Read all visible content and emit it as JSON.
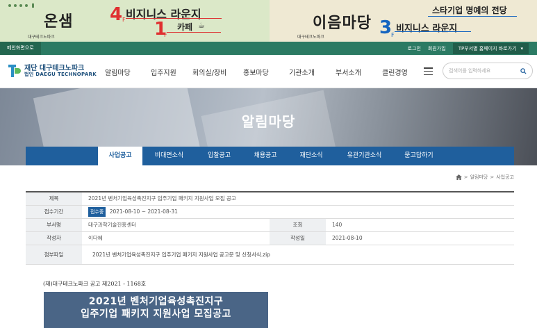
{
  "banner": {
    "left": {
      "title": "온샘",
      "floor1_number": "4",
      "floor1_unit": "F",
      "floor1_title": "비지니스 라운지",
      "floor2_number": "1",
      "floor2_unit": "F",
      "floor2_title": "카페",
      "org_small": "대구테크노파크"
    },
    "right": {
      "title": "이음마당",
      "top_title": "스타기업 명예의 전당",
      "floor_number": "3",
      "floor_unit": "F",
      "floor_title": "비지니스 라운지",
      "org_small": "대구테크노파크"
    }
  },
  "utilbar": {
    "home_link": "메인화면으로",
    "login": "로그인",
    "join": "회원가입",
    "tp_select": "TP부서별 홈페이지 바로가기"
  },
  "header": {
    "logo_ko": "재단 대구테크노파크",
    "logo_en": "법인 DAEGU TECHNOPARK",
    "nav": [
      "알림마당",
      "입주지원",
      "회의실/장비",
      "홍보마당",
      "기관소개",
      "부서소개",
      "클린경영"
    ],
    "search_placeholder": "검색어를 입력하세요"
  },
  "hero": {
    "title": "알림마당"
  },
  "subnav": {
    "items": [
      "사업공고",
      "비대면소식",
      "입찰공고",
      "채용공고",
      "재단소식",
      "유관기관소식",
      "묻고답하기"
    ],
    "active_index": 0
  },
  "breadcrumb": {
    "level1": "알림마당",
    "level2": "사업공고"
  },
  "post": {
    "title_label": "제목",
    "title_value": "2021년 벤처기업육성촉진지구 입주기업 패키지 지원사업 모집 공고",
    "period_label": "접수기간",
    "period_badge": "접수중",
    "period_value": "2021-08-10 ~ 2021-08-31",
    "dept_label": "부서명",
    "dept_value": "대구과학기술진흥센터",
    "views_label": "조회",
    "views_value": "140",
    "author_label": "작성자",
    "author_value": "이다혜",
    "date_label": "작성일",
    "date_value": "2021-08-10",
    "attach_label": "첨부파일",
    "attach_value": "2021년 벤처기업육성촉진지구 입주기업 패키지 지원사업 공고문 및 신청서식.zip"
  },
  "body": {
    "doc_no": "(재)대구테크노파크 공고 제2021 - 1168호",
    "poster_line1": "2021년 벤처기업육성촉진지구",
    "poster_line2": "입주기업 패키지 지원사업 모집공고"
  },
  "colors": {
    "brand_green": "#2b7a63",
    "brand_blue": "#1f5f9d",
    "poster_bg": "#4a6586"
  }
}
